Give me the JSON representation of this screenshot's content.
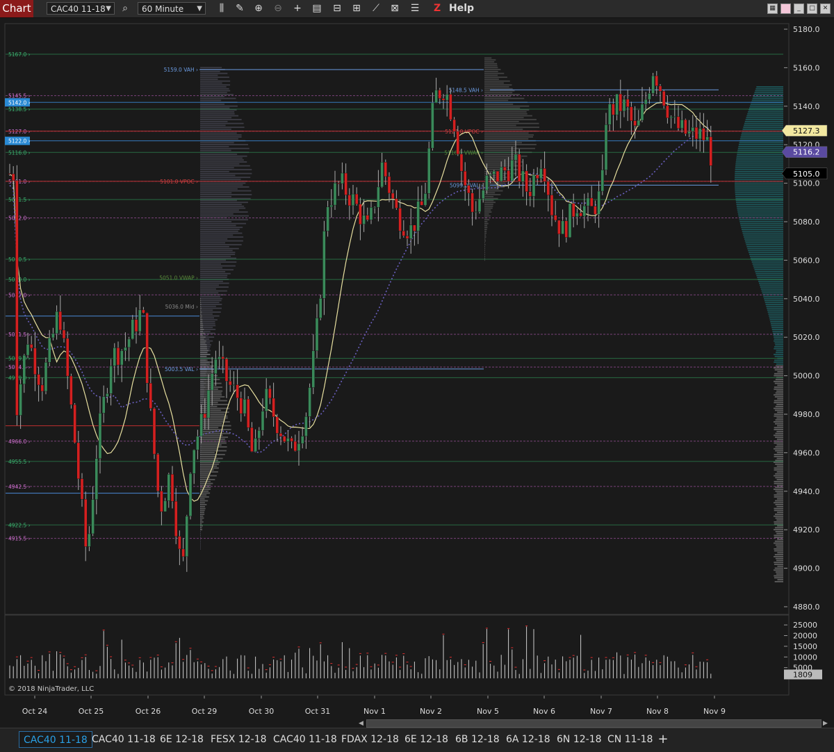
{
  "toolbar": {
    "chart_label": "Chart",
    "instrument": "CAC40 11-18",
    "timeframe": "60 Minute",
    "help_prefix": "Z",
    "help_label": "Help",
    "icons": [
      "search-icon",
      "bar-type-icon",
      "pencil-draw-icon",
      "zoom-in-icon",
      "zoom-out-icon",
      "crosshair-icon",
      "properties-icon",
      "data-box-icon",
      "template-icon",
      "strategies-icon",
      "indicators-icon",
      "chart-trader-icon"
    ]
  },
  "chart_data": {
    "type": "candlestick",
    "instrument": "CAC40 11-18",
    "interval": "60 Minute",
    "ylim": [
      4875,
      5185
    ],
    "y_ticks": [
      5180.0,
      5160.0,
      5140.0,
      5120.0,
      5100.0,
      5080.0,
      5060.0,
      5040.0,
      5020.0,
      5000.0,
      4980.0,
      4960.0,
      4940.0,
      4920.0,
      4900.0,
      4880.0
    ],
    "x_labels": [
      "Oct 24",
      "Oct 25",
      "Oct 26",
      "Oct 29",
      "Oct 30",
      "Oct 31",
      "Nov 1",
      "Nov 2",
      "Nov 5",
      "Nov 6",
      "Nov 7",
      "Nov 8",
      "Nov 9"
    ],
    "price_markers": {
      "last_close": "5105.0",
      "yellow": "5127.3",
      "purple": "5116.2"
    },
    "left_levels": [
      {
        "label": "5167.0",
        "value": 5167.0,
        "color": "#3cb371"
      },
      {
        "label": "5145.5",
        "value": 5145.5,
        "color": "#d070d0"
      },
      {
        "label": "5142.0",
        "value": 5142.0,
        "color": "#2a8ad4"
      },
      {
        "label": "5138.5",
        "value": 5138.5,
        "color": "#3cb371"
      },
      {
        "label": "5127.0",
        "value": 5127.0,
        "color": "#d070d0"
      },
      {
        "label": "5122.0",
        "value": 5122.0,
        "color": "#2a8ad4"
      },
      {
        "label": "5116.0",
        "value": 5116.0,
        "color": "#3cb371"
      },
      {
        "label": "5101.0",
        "value": 5101.0,
        "color": "#d070d0"
      },
      {
        "label": "5091.5",
        "value": 5091.5,
        "color": "#3cb371"
      },
      {
        "label": "5082.0",
        "value": 5082.0,
        "color": "#d070d0"
      },
      {
        "label": "5060.5",
        "value": 5060.5,
        "color": "#3cb371"
      },
      {
        "label": "5050.0",
        "value": 5050.0,
        "color": "#3cb371"
      },
      {
        "label": "5042.0",
        "value": 5042.0,
        "color": "#d070d0"
      },
      {
        "label": "5021.5",
        "value": 5021.5,
        "color": "#d070d0"
      },
      {
        "label": "5009.0",
        "value": 5009.0,
        "color": "#3cb371"
      },
      {
        "label": "5004.5",
        "value": 5004.5,
        "color": "#d070d0"
      },
      {
        "label": "4999.0",
        "value": 4999.0,
        "color": "#3cb371"
      },
      {
        "label": "4966.0",
        "value": 4966.0,
        "color": "#d070d0"
      },
      {
        "label": "4955.5",
        "value": 4955.5,
        "color": "#3cb371"
      },
      {
        "label": "4942.5",
        "value": 4942.5,
        "color": "#d070d0"
      },
      {
        "label": "4922.5",
        "value": 4922.5,
        "color": "#3cb371"
      },
      {
        "label": "4915.5",
        "value": 4915.5,
        "color": "#d070d0"
      }
    ],
    "profile_labels": [
      {
        "label": "5159.0 VAH",
        "value": 5159.0,
        "color": "#6a9ae0"
      },
      {
        "label": "5101.0 VPOC",
        "value": 5101.0,
        "color": "#d04040"
      },
      {
        "label": "5051.0 VWAP",
        "value": 5051.0,
        "color": "#5a8a3a"
      },
      {
        "label": "5036.0 Mid",
        "value": 5036.0,
        "color": "#888888"
      },
      {
        "label": "5003.5 VAL",
        "value": 5003.5,
        "color": "#6a9ae0"
      },
      {
        "label": "5148.5 VAH",
        "value": 5148.5,
        "color": "#6a9ae0"
      },
      {
        "label": "5127.0 VPOC",
        "value": 5127.0,
        "color": "#d04040"
      },
      {
        "label": "5116.0 VWAP",
        "value": 5116.0,
        "color": "#5a8a3a"
      },
      {
        "label": "5099.0 VAL",
        "value": 5099.0,
        "color": "#6a9ae0"
      }
    ],
    "volume": {
      "y_ticks": [
        "25000",
        "20000",
        "15000",
        "10000",
        "5000"
      ],
      "last_volume": "1809"
    },
    "copyright": "© 2018 NinjaTrader, LLC"
  },
  "tabs": [
    "CAC40 11-18",
    "CAC40 11-18",
    "6E 12-18",
    "FESX 12-18",
    "CAC40 11-18",
    "FDAX 12-18",
    "6E 12-18",
    "6B 12-18",
    "6A 12-18",
    "6N 12-18",
    "CN 11-18"
  ],
  "tab_add": "+"
}
